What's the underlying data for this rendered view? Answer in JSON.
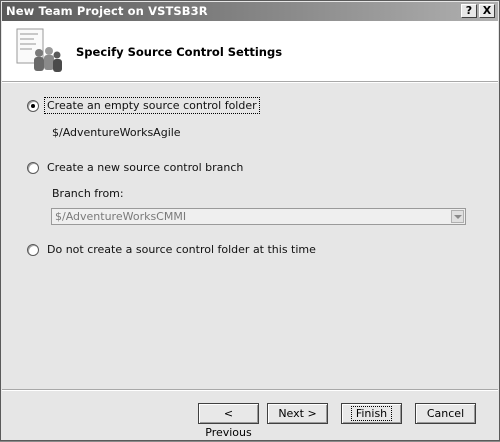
{
  "window": {
    "title": "New Team Project on VSTSB3R",
    "help_glyph": "?",
    "close_glyph": "X"
  },
  "header": {
    "title": "Specify Source Control Settings",
    "icon": "wizard-people-icon"
  },
  "options": {
    "empty_folder": {
      "label": "Create an empty source control folder",
      "checked": true
    },
    "empty_folder_path": "$/AdventureWorksAgile",
    "new_branch": {
      "label": "Create a new source control branch",
      "checked": false
    },
    "branch_from_label": "Branch from:",
    "branch_from_value": "$/AdventureWorksCMMI",
    "no_folder": {
      "label": "Do not create a source control folder at this time",
      "checked": false
    }
  },
  "buttons": {
    "previous": "< Previous",
    "next": "Next >",
    "finish": "Finish",
    "cancel": "Cancel"
  },
  "colors": {
    "titlebar_start": "#5a5a5a",
    "dialog_bg": "#e6e6e6",
    "header_bg": "#ffffff"
  }
}
